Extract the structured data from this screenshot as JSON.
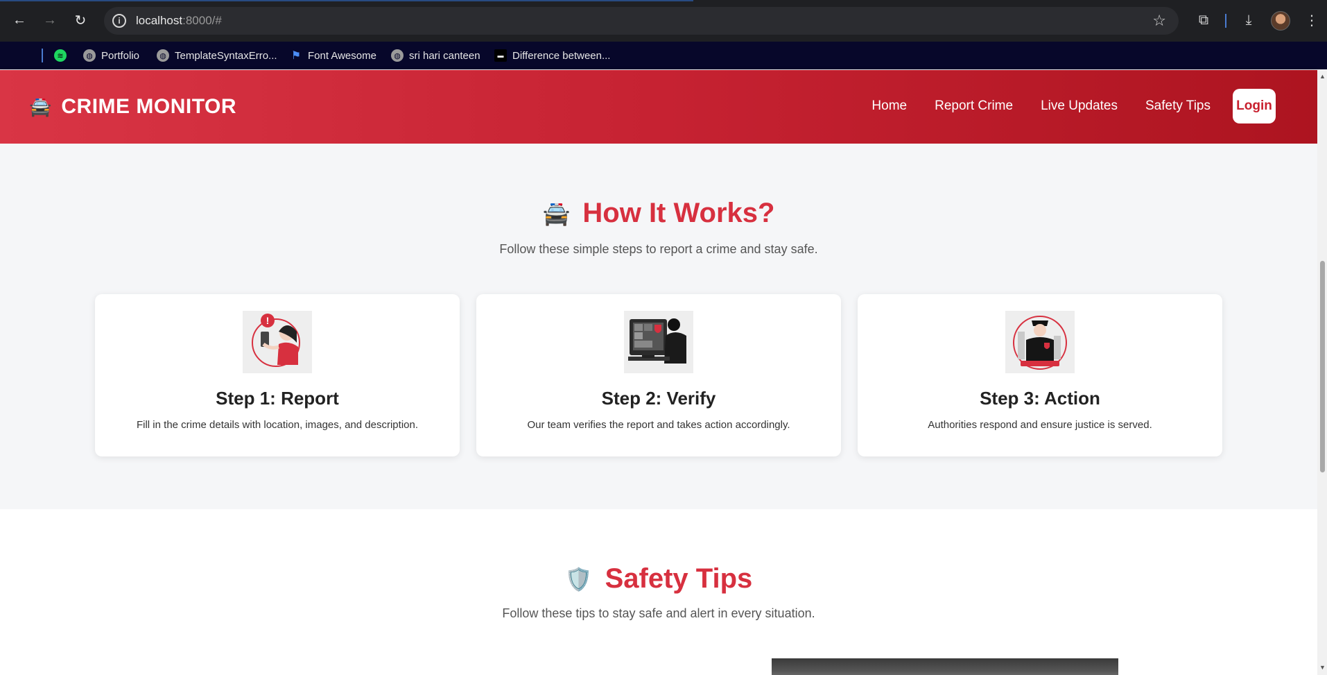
{
  "browser": {
    "url_host": "localhost",
    "url_rest": ":8000/#",
    "bookmarks": [
      {
        "label": "Portfolio",
        "icon": "globe-icon"
      },
      {
        "label": "TemplateSyntaxErro...",
        "icon": "globe-icon"
      },
      {
        "label": "Font Awesome",
        "icon": "flag-icon"
      },
      {
        "label": "sri hari canteen",
        "icon": "globe-icon"
      },
      {
        "label": "Difference between...",
        "icon": "page-icon"
      }
    ]
  },
  "header": {
    "brand_icon": "🚔",
    "brand": "CRIME MONITOR",
    "nav": [
      "Home",
      "Report Crime",
      "Live Updates",
      "Safety Tips"
    ],
    "login": "Login"
  },
  "how": {
    "icon": "🚔",
    "title": "How It Works?",
    "subtitle": "Follow these simple steps to report a crime and stay safe.",
    "steps": [
      {
        "title": "Step 1: Report",
        "text": "Fill in the crime details with location, images, and description."
      },
      {
        "title": "Step 2: Verify",
        "text": "Our team verifies the report and takes action accordingly."
      },
      {
        "title": "Step 3: Action",
        "text": "Authorities respond and ensure justice is served."
      }
    ]
  },
  "tips": {
    "icon": "🛡️",
    "title": "Safety Tips",
    "subtitle": "Follow these tips to stay safe and alert in every situation."
  },
  "colors": {
    "accent": "#d7303f",
    "header_start": "#d93545",
    "header_end": "#ad1420"
  }
}
